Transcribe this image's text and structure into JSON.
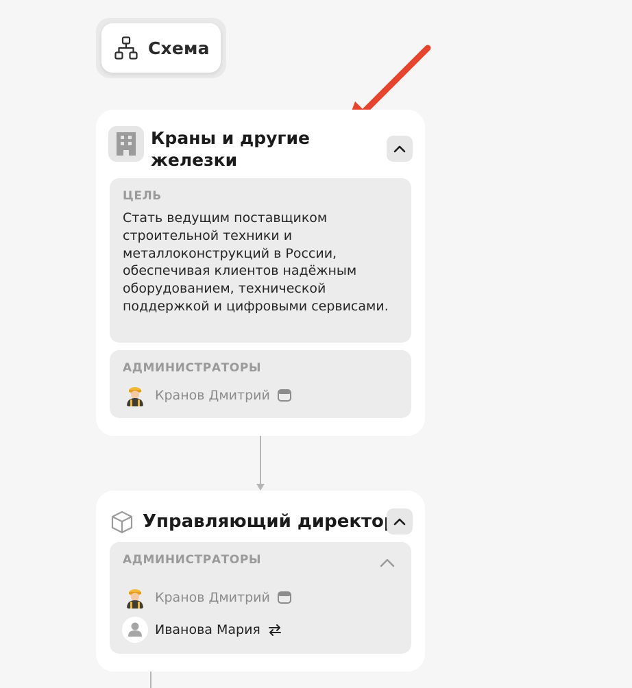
{
  "toolbar": {
    "schema_label": "Схема"
  },
  "cards": [
    {
      "title": "Краны и другие железки",
      "goal_label": "ЦЕЛЬ",
      "goal_text": "Стать ведущим поставщиком строительной техники и металлоконструкций в России, обеспечивая клиентов надёжным оборудованием, технической поддержкой и цифровыми сервисами.",
      "admins_label": "АДМИНИСТРАТОРЫ",
      "admins": [
        {
          "name": "Кранов Дмитрий"
        }
      ]
    },
    {
      "title": "Управляющий директор",
      "admins_label": "АДМИНИСТРАТОРЫ",
      "admins": [
        {
          "name": "Кранов Дмитрий"
        },
        {
          "name": "Иванова Мария"
        }
      ]
    }
  ],
  "colors": {
    "accent_arrow": "#e8432d",
    "card_bg": "#ffffff",
    "section_bg": "#ececec",
    "page_bg": "#f6f6f6"
  },
  "icons": [
    "hierarchy-icon",
    "building-icon",
    "chevron-up-icon",
    "worker-avatar-icon",
    "calendar-icon",
    "cube-icon",
    "user-icon",
    "swap-icon"
  ]
}
